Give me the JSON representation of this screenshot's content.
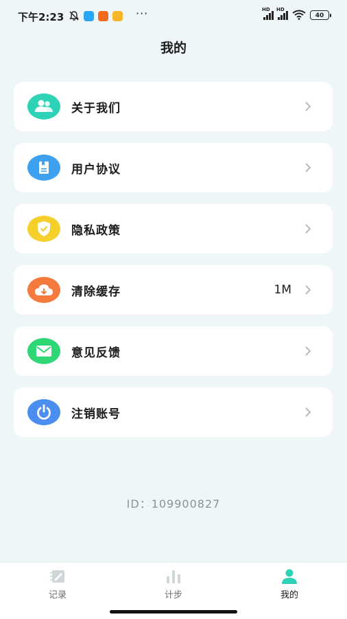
{
  "status_bar": {
    "time": "下午2:23",
    "battery": "40"
  },
  "header": {
    "title": "我的"
  },
  "menu": [
    {
      "label": "关于我们",
      "value": "",
      "icon": "users-icon"
    },
    {
      "label": "用户协议",
      "value": "",
      "icon": "document-icon"
    },
    {
      "label": "隐私政策",
      "value": "",
      "icon": "shield-icon"
    },
    {
      "label": "清除缓存",
      "value": "1M",
      "icon": "cloud-download-icon"
    },
    {
      "label": "意见反馈",
      "value": "",
      "icon": "mail-icon"
    },
    {
      "label": "注销账号",
      "value": "",
      "icon": "power-icon"
    }
  ],
  "user_id": "ID：109900827",
  "tabs": [
    {
      "label": "记录",
      "icon": "record-icon",
      "active": false
    },
    {
      "label": "计步",
      "icon": "bar-chart-icon",
      "active": false
    },
    {
      "label": "我的",
      "icon": "person-icon",
      "active": true
    }
  ],
  "colors": {
    "background": "#eef6f7",
    "users": "#2ed3b7",
    "document": "#3ea1f0",
    "shield": "#f5cf2a",
    "cloud": "#f57a3e",
    "mail": "#2fd675",
    "power": "#4a8ef0",
    "active_tab": "#2ed3b7"
  }
}
